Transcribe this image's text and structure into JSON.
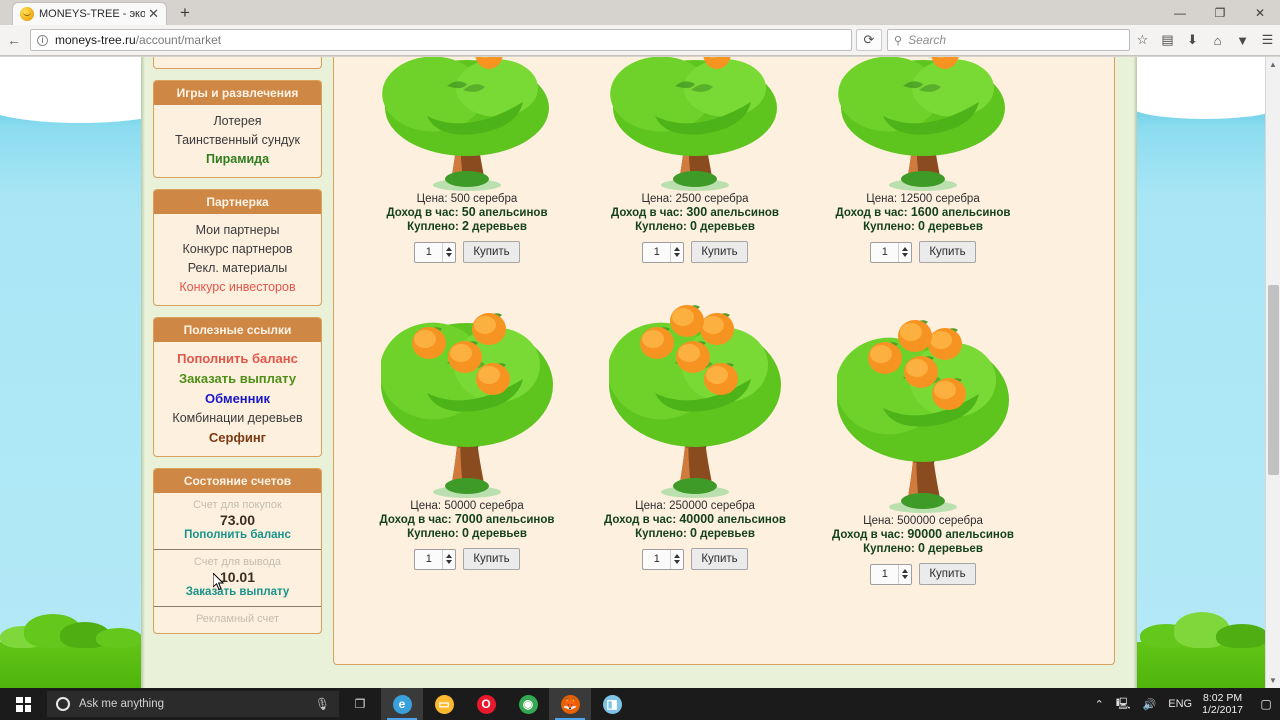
{
  "browser": {
    "tab_title": "MONEYS-TREE - экономи...",
    "tab_close": "✕",
    "new_tab": "+",
    "minimize": "—",
    "maximize": "❐",
    "close": "✕",
    "back": "←",
    "info": "i",
    "url_domain": "moneys-tree.ru",
    "url_path": "/account/market",
    "reload": "⟳",
    "search_placeholder": "Search",
    "search_icon": "⚲",
    "bookmark_star": "☆",
    "library": "▤",
    "downloads": "⬇",
    "home": "⌂",
    "pocket": "▼",
    "menu": "☰"
  },
  "sidebar": {
    "blocks": [
      {
        "title": "Игры и развлечения",
        "items": [
          {
            "label": "Лотерея",
            "style": ""
          },
          {
            "label": "Таинственный сундук",
            "style": ""
          },
          {
            "label": "Пирамида",
            "style": "green"
          }
        ]
      },
      {
        "title": "Партнерка",
        "items": [
          {
            "label": "Мои партнеры",
            "style": ""
          },
          {
            "label": "Конкурс партнеров",
            "style": ""
          },
          {
            "label": "Рекл. материалы",
            "style": ""
          },
          {
            "label": "Конкурс инвесторов",
            "style": "red"
          }
        ]
      },
      {
        "title": "Полезные ссылки",
        "items": [
          {
            "label": "Пополнить баланс",
            "style": "redb"
          },
          {
            "label": "Заказать выплату",
            "style": "greenb"
          },
          {
            "label": "Обменник",
            "style": "blueb"
          },
          {
            "label": "Комбинации деревьев",
            "style": ""
          },
          {
            "label": "Серфинг",
            "style": "brownb"
          }
        ]
      }
    ],
    "accounts_title": "Состояние счетов",
    "accounts": [
      {
        "label": "Счет для покупок",
        "value": "73.00",
        "link": "Пополнить баланс"
      },
      {
        "label": "Счет для вывода",
        "value": "10.01",
        "link": "Заказать выплату"
      },
      {
        "label": "Рекламный счет",
        "value": "",
        "link": ""
      }
    ]
  },
  "market": {
    "price_prefix": "Цена:",
    "price_suffix": "серебра",
    "income_prefix": "Доход в час:",
    "income_suffix": "апельсинов",
    "owned_prefix": "Куплено:",
    "owned_suffix": "деревьев",
    "buy_label": "Купить",
    "qty_value": "1",
    "cards": [
      {
        "price": "500",
        "income": "50",
        "owned": "2",
        "size": "small",
        "fruits": 1
      },
      {
        "price": "2500",
        "income": "300",
        "owned": "0",
        "size": "small",
        "fruits": 1
      },
      {
        "price": "12500",
        "income": "1600",
        "owned": "0",
        "size": "small",
        "fruits": 1
      },
      {
        "price": "50000",
        "income": "7000",
        "owned": "0",
        "size": "big",
        "fruits": 4
      },
      {
        "price": "250000",
        "income": "40000",
        "owned": "0",
        "size": "big",
        "fruits": 5
      },
      {
        "price": "500000",
        "income": "90000",
        "owned": "0",
        "size": "big",
        "fruits": 5
      }
    ]
  },
  "taskbar": {
    "cortana_placeholder": "Ask me anything",
    "mic_icon": "🎙",
    "taskview_icon": "❐",
    "apps": [
      {
        "name": "edge",
        "glyph": "e",
        "color": "#3aa0dd",
        "active": true
      },
      {
        "name": "file-explorer",
        "glyph": "▭",
        "color": "#ffb92e",
        "active": false
      },
      {
        "name": "opera",
        "glyph": "O",
        "color": "#e8192c",
        "active": false
      },
      {
        "name": "chrome",
        "glyph": "◉",
        "color": "#34a853",
        "active": false
      },
      {
        "name": "firefox",
        "glyph": "🦊",
        "color": "#e66000",
        "active": true
      },
      {
        "name": "bluestacks",
        "glyph": "◨",
        "color": "#7fc4e8",
        "active": false
      }
    ],
    "tray_up": "⌃",
    "tray_network": "🖳",
    "tray_volume": "🔊",
    "language": "ENG",
    "time": "8:02 PM",
    "date": "1/2/2017",
    "notification_icon": "▢"
  },
  "colors": {
    "header_brown": "#cf8746",
    "panel_cream": "#fdf0df",
    "page_green": "#e9f2d9",
    "sky_blue": "#b4e9f7",
    "ground_green": "#5cc014"
  }
}
